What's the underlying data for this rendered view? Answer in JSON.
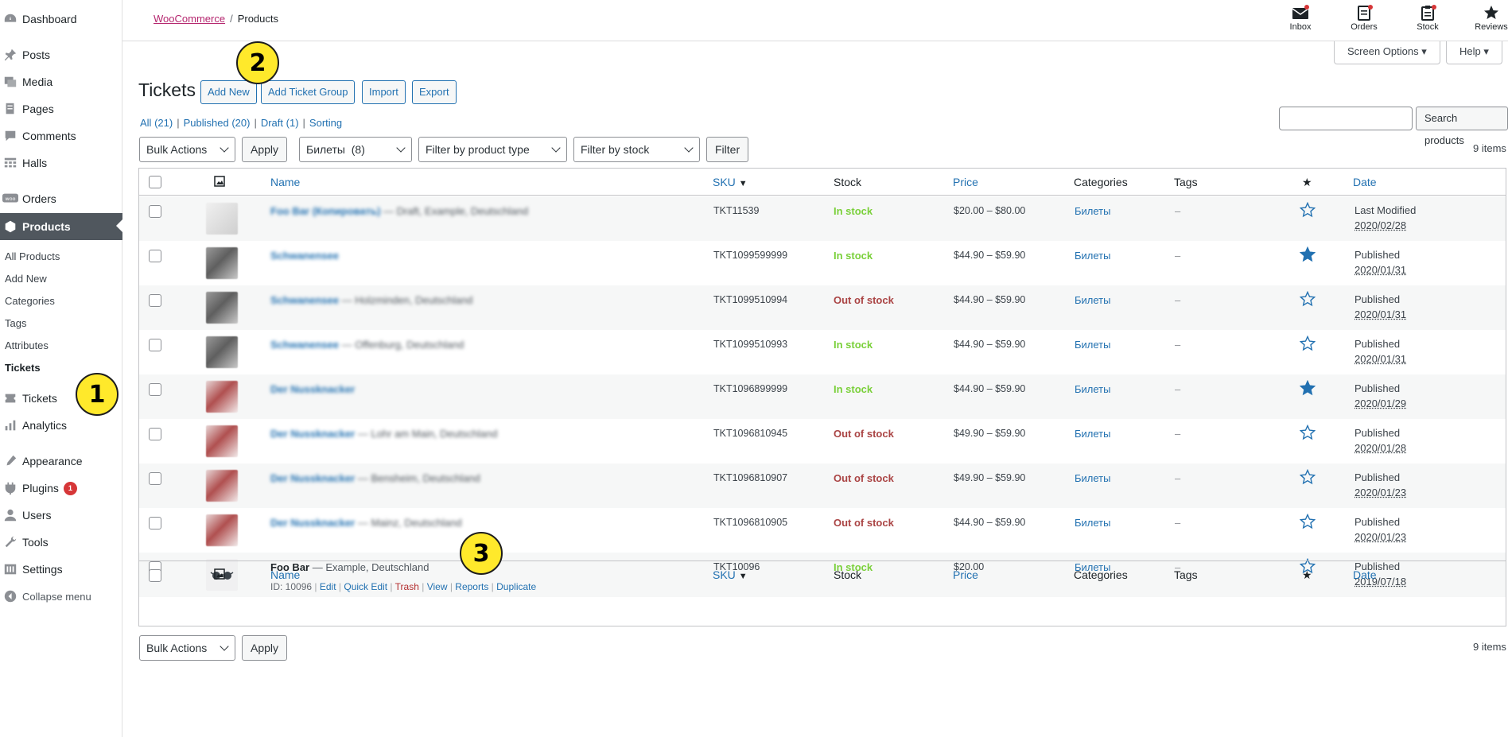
{
  "sidebar": {
    "menu": [
      {
        "label": "Dashboard",
        "icon": "dashboard-icon"
      },
      {
        "label": "Posts",
        "icon": "pin-icon"
      },
      {
        "label": "Media",
        "icon": "media-icon"
      },
      {
        "label": "Pages",
        "icon": "pages-icon"
      },
      {
        "label": "Comments",
        "icon": "comments-icon"
      },
      {
        "label": "Halls",
        "icon": "halls-icon"
      },
      {
        "label": "Orders",
        "icon": "woo-icon"
      },
      {
        "label": "Products",
        "icon": "products-icon"
      }
    ],
    "submenu": [
      "All Products",
      "Add New",
      "Categories",
      "Tags",
      "Attributes",
      "Tickets"
    ],
    "menu2": [
      {
        "label": "Tickets",
        "icon": "tickets-icon"
      },
      {
        "label": "Analytics",
        "icon": "analytics-icon"
      },
      {
        "label": "Appearance",
        "icon": "appearance-icon"
      },
      {
        "label": "Plugins",
        "icon": "plugins-icon",
        "badge": "1"
      },
      {
        "label": "Users",
        "icon": "users-icon"
      },
      {
        "label": "Tools",
        "icon": "tools-icon"
      },
      {
        "label": "Settings",
        "icon": "settings-icon"
      },
      {
        "label": "Collapse menu",
        "icon": "collapse-icon"
      }
    ]
  },
  "header": {
    "breadcrumb_link": "WooCommerce",
    "breadcrumb_sep": "/",
    "breadcrumb_current": "Products",
    "actions": [
      "Inbox",
      "Orders",
      "Stock",
      "Reviews"
    ],
    "screen_options": "Screen Options",
    "help": "Help"
  },
  "page": {
    "title": "Tickets",
    "buttons": [
      "Add New",
      "Add Ticket Group",
      "Import",
      "Export"
    ],
    "views": [
      {
        "label": "All",
        "count": "(21)"
      },
      {
        "label": "Published",
        "count": "(20)"
      },
      {
        "label": "Draft",
        "count": "(1)"
      },
      {
        "label": "Sorting",
        "count": ""
      }
    ],
    "views_sep": "|",
    "search_button": "Search products",
    "bulk_actions": "Bulk Actions",
    "apply": "Apply",
    "category_filter": "Билеты  (8)",
    "product_type_filter": "Filter by product type",
    "stock_filter": "Filter by stock status",
    "filter_button": "Filter",
    "items_count": "9 items"
  },
  "table": {
    "columns": {
      "name": "Name",
      "sku": "SKU",
      "stock": "Stock",
      "price": "Price",
      "categories": "Categories",
      "tags": "Tags",
      "date": "Date",
      "sort_arrow": "▼",
      "featured_icon": "★"
    },
    "rows": [
      {
        "name": "Foo Bar (Копировать)",
        "suffix": " — Draft, Example, Deutschland",
        "sku": "TKT11539",
        "stock": "In stock",
        "stock_ok": true,
        "price": "$20.00 – $80.00",
        "category": "Билеты",
        "tags": "–",
        "featured": false,
        "status": "Last Modified",
        "date": "2020/02/28",
        "thumb": "light"
      },
      {
        "name": "Schwanensee",
        "suffix": "",
        "sku": "TKT1099599999",
        "stock": "In stock",
        "stock_ok": true,
        "price": "$44.90 – $59.90",
        "category": "Билеты",
        "tags": "–",
        "featured": true,
        "status": "Published",
        "date": "2020/01/31",
        "thumb": "dark"
      },
      {
        "name": "Schwanensee",
        "suffix": " — Holzminden, Deutschland",
        "sku": "TKT1099510994",
        "stock": "Out of stock",
        "stock_ok": false,
        "price": "$44.90 – $59.90",
        "category": "Билеты",
        "tags": "–",
        "featured": false,
        "status": "Published",
        "date": "2020/01/31",
        "thumb": "dark"
      },
      {
        "name": "Schwanensee",
        "suffix": " — Offenburg, Deutschland",
        "sku": "TKT1099510993",
        "stock": "In stock",
        "stock_ok": true,
        "price": "$44.90 – $59.90",
        "category": "Билеты",
        "tags": "–",
        "featured": false,
        "status": "Published",
        "date": "2020/01/31",
        "thumb": "dark"
      },
      {
        "name": "Der Nussknacker",
        "suffix": "",
        "sku": "TKT1096899999",
        "stock": "In stock",
        "stock_ok": true,
        "price": "$44.90 – $59.90",
        "category": "Билеты",
        "tags": "–",
        "featured": true,
        "status": "Published",
        "date": "2020/01/29",
        "thumb": "red"
      },
      {
        "name": "Der Nussknacker",
        "suffix": " — Lohr am Main, Deutschland",
        "sku": "TKT1096810945",
        "stock": "Out of stock",
        "stock_ok": false,
        "price": "$49.90 – $59.90",
        "category": "Билеты",
        "tags": "–",
        "featured": false,
        "status": "Published",
        "date": "2020/01/28",
        "thumb": "red"
      },
      {
        "name": "Der Nussknacker",
        "suffix": " — Bensheim, Deutschland",
        "sku": "TKT1096810907",
        "stock": "Out of stock",
        "stock_ok": false,
        "price": "$49.90 – $59.90",
        "category": "Билеты",
        "tags": "–",
        "featured": false,
        "status": "Published",
        "date": "2020/01/23",
        "thumb": "red"
      },
      {
        "name": "Der Nussknacker",
        "suffix": " — Mainz, Deutschland",
        "sku": "TKT1096810905",
        "stock": "Out of stock",
        "stock_ok": false,
        "price": "$44.90 – $59.90",
        "category": "Билеты",
        "tags": "–",
        "featured": false,
        "status": "Published",
        "date": "2020/01/23",
        "thumb": "red"
      },
      {
        "name": "Foo Bar",
        "suffix": " — Example, Deutschland",
        "sku": "TKT10096",
        "stock": "In stock",
        "stock_ok": true,
        "price": "$20.00",
        "category": "Билеты",
        "tags": "–",
        "featured": false,
        "status": "Published",
        "date": "2019/07/18",
        "thumb": "clear"
      }
    ],
    "row_actions": {
      "id": "ID: 10096",
      "sep": "|",
      "edit": "Edit",
      "quick_edit": "Quick Edit",
      "trash": "Trash",
      "view": "View",
      "reports": "Reports",
      "duplicate": "Duplicate"
    }
  },
  "callouts": [
    "1",
    "2",
    "3"
  ],
  "colors": {
    "accent": "#2271b1",
    "in_stock": "#7ad03a",
    "out_of_stock": "#aa4444",
    "active_menu": "#50575e",
    "callout": "#ffe92b",
    "woo_link": "#b5276f"
  }
}
